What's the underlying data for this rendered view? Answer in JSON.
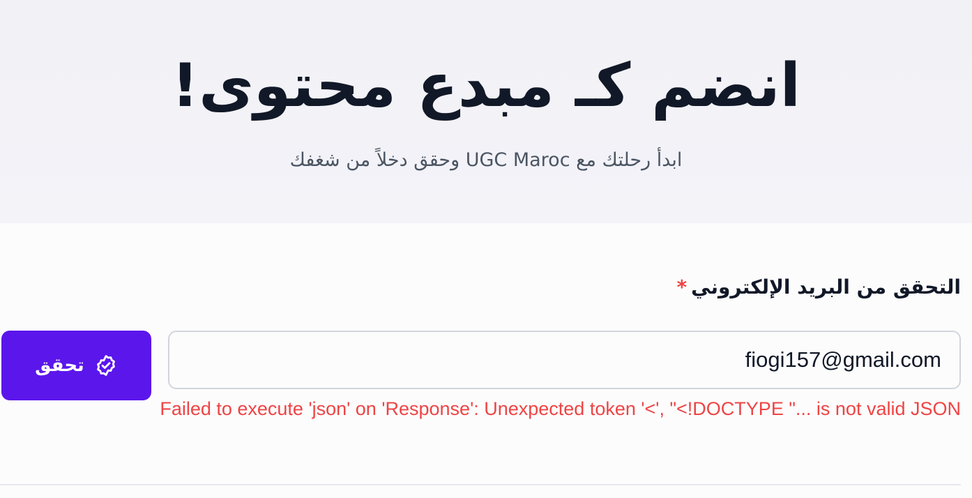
{
  "hero": {
    "title": "انضم كـ مبدع محتوى!",
    "subtitle": "ابدأ رحلتك مع UGC Maroc وحقق دخلاً من شغفك"
  },
  "form": {
    "email_label": "التحقق من البريد الإلكتروني",
    "required_marker": "*",
    "email_value": "fiogi157@gmail.com",
    "verify_label": "تحقق",
    "verify_icon": "badge-check-icon",
    "error_message": "Failed to execute 'json' on 'Response': Unexpected token '<', \"<!DOCTYPE \"... is not valid JSON"
  },
  "colors": {
    "accent": "#5b16ec",
    "error": "#ef4444",
    "title": "#111827",
    "subtitle": "#4b5563"
  }
}
